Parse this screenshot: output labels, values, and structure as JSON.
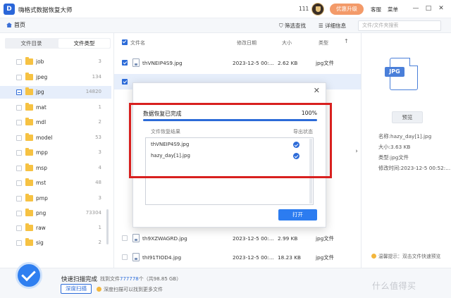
{
  "titlebar": {
    "logo_letter": "D",
    "app_title": "嗨格式数据恢复大师",
    "count": "111",
    "upgrade_label": "优惠升级",
    "service_label": "客服",
    "menu_label": "菜单",
    "minimize": "—",
    "maximize": "□",
    "close": "✕"
  },
  "toolbar": {
    "home_label": "首页",
    "filter_label": "筛选查找",
    "detail_label": "详细信息",
    "search_placeholder": "文件/文件夹搜索"
  },
  "sidebar": {
    "tab_directory": "文件目录",
    "tab_type": "文件类型",
    "items": [
      {
        "name": "job",
        "count": "3"
      },
      {
        "name": "jpeg",
        "count": "134"
      },
      {
        "name": "jpg",
        "count": "14820"
      },
      {
        "name": "mat",
        "count": "1"
      },
      {
        "name": "mdl",
        "count": "2"
      },
      {
        "name": "model",
        "count": "53"
      },
      {
        "name": "mpp",
        "count": "3"
      },
      {
        "name": "msp",
        "count": "4"
      },
      {
        "name": "mst",
        "count": "48"
      },
      {
        "name": "pmp",
        "count": "3"
      },
      {
        "name": "png",
        "count": "73304"
      },
      {
        "name": "raw",
        "count": "1"
      },
      {
        "name": "sig",
        "count": "2"
      }
    ]
  },
  "filelist": {
    "col_name": "文件名",
    "col_modified": "修改日期",
    "col_size": "大小",
    "col_type": "类型",
    "rows": [
      {
        "name": "thVNEIP4S9.jpg",
        "modified": "2023-12-5 00:...",
        "size": "2.62 KB",
        "type": "jpg文件"
      },
      {
        "name": "th9XZWAGRD.jpg",
        "modified": "2023-12-5 00:...",
        "size": "2.99 KB",
        "type": "jpg文件"
      },
      {
        "name": "thI91TIOD4.jpg",
        "modified": "2023-12-5 00:...",
        "size": "18.23 KB",
        "type": "jpg文件"
      }
    ]
  },
  "preview": {
    "file_badge": "JPG",
    "preview_label": "预览",
    "name_line": "名称:hazy_day[1].jpg",
    "size_line": "大小:3.63 KB",
    "type_line": "类型:jpg文件",
    "modified_line": "修改时间:2023-12-5 00:52:...",
    "tip": "温馨提示：双击文件快速预览"
  },
  "bottombar": {
    "scan_title": "快速扫描完成",
    "stats_prefix": "找到文件",
    "stats_count": "777778",
    "stats_suffix": "个（共98.85 GB）",
    "deep_scan_label": "深度扫描",
    "deep_tip": "深度扫描可以找到更多文件"
  },
  "modal": {
    "close": "✕",
    "status": "数据恢复已完成",
    "percent_label": "100%",
    "progress": 1.0,
    "col_result": "文件恢复结果",
    "col_export": "导出状态",
    "results": [
      {
        "name": "thVNEIP4S9.jpg"
      },
      {
        "name": "hazy_day[1].jpg"
      }
    ],
    "open_label": "打开"
  },
  "watermark": "什么值得买",
  "colors": {
    "accent": "#2c6bd8",
    "upgrade": "#f39a69",
    "highlight_frame": "#d8201f",
    "folder": "#f6c243"
  }
}
